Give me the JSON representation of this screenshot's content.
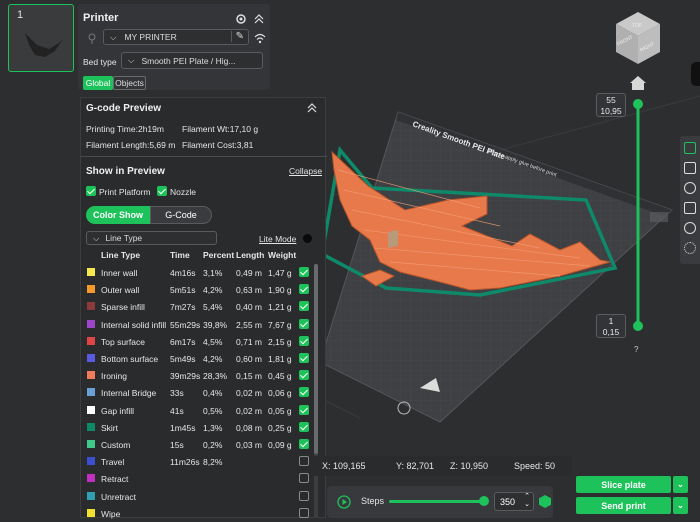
{
  "plate": {
    "number": "1"
  },
  "printer": {
    "title": "Printer",
    "printer_name": "MY PRINTER",
    "bed_type_label": "Bed type",
    "bed_type_value": "Smooth PEI Plate / Hig...",
    "tab_global": "Global",
    "tab_objects": "Objects"
  },
  "gcode": {
    "title": "G-code Preview",
    "printing_time": "Printing Time:2h19m",
    "filament_wt": "Filament Wt:17,10 g",
    "filament_length": "Filament Length:5,69 m",
    "filament_cost": "Filament Cost:3,81"
  },
  "show": {
    "title": "Show in Preview",
    "collapse": "Collapse",
    "print_platform": "Print Platform",
    "nozzle": "Nozzle",
    "color_show": "Color Show",
    "gcode_tab": "G-Code",
    "line_type_select": "Line Type",
    "lite_mode": "Lite Mode"
  },
  "table": {
    "headers": [
      "Line Type",
      "Time",
      "Percent",
      "Length",
      "Weight"
    ],
    "rows": [
      {
        "color": "#f5e84a",
        "name": "Inner wall",
        "time": "4m16s",
        "percent": "3,1%",
        "length": "0,49 m",
        "weight": "1,47 g",
        "checked": true
      },
      {
        "color": "#f59a2a",
        "name": "Outer wall",
        "time": "5m51s",
        "percent": "4,2%",
        "length": "0,63 m",
        "weight": "1,90 g",
        "checked": true
      },
      {
        "color": "#8b3a3a",
        "name": "Sparse infill",
        "time": "7m27s",
        "percent": "5,4%",
        "length": "0,40 m",
        "weight": "1,21 g",
        "checked": true
      },
      {
        "color": "#9b45c9",
        "name": "Internal solid infill",
        "time": "55m29s",
        "percent": "39,8%",
        "length": "2,55 m",
        "weight": "7,67 g",
        "checked": true
      },
      {
        "color": "#e04545",
        "name": "Top surface",
        "time": "6m17s",
        "percent": "4,5%",
        "length": "0,71 m",
        "weight": "2,15 g",
        "checked": true
      },
      {
        "color": "#5a5ae0",
        "name": "Bottom surface",
        "time": "5m49s",
        "percent": "4,2%",
        "length": "0,60 m",
        "weight": "1,81 g",
        "checked": true
      },
      {
        "color": "#f07a5a",
        "name": "Ironing",
        "time": "39m29s",
        "percent": "28,3%",
        "length": "0,15 m",
        "weight": "0,45 g",
        "checked": true
      },
      {
        "color": "#6aa0d8",
        "name": "Internal Bridge",
        "time": "33s",
        "percent": "0,4%",
        "length": "0,02 m",
        "weight": "0,06 g",
        "checked": true
      },
      {
        "color": "#ffffff",
        "name": "Gap infill",
        "time": "41s",
        "percent": "0,5%",
        "length": "0,02 m",
        "weight": "0,05 g",
        "checked": true
      },
      {
        "color": "#0e8a6a",
        "name": "Skirt",
        "time": "1m45s",
        "percent": "1,3%",
        "length": "0,08 m",
        "weight": "0,25 g",
        "checked": true
      },
      {
        "color": "#3ec88a",
        "name": "Custom",
        "time": "15s",
        "percent": "0,2%",
        "length": "0,03 m",
        "weight": "0,09 g",
        "checked": true
      },
      {
        "color": "#3a4fd0",
        "name": "Travel",
        "time": "11m26s",
        "percent": "8,2%",
        "length": "",
        "weight": "",
        "checked": false
      },
      {
        "color": "#c030c0",
        "name": "Retract",
        "time": "",
        "percent": "",
        "length": "",
        "weight": "",
        "checked": false
      },
      {
        "color": "#30a0b0",
        "name": "Unretract",
        "time": "",
        "percent": "",
        "length": "",
        "weight": "",
        "checked": false
      },
      {
        "color": "#f0e030",
        "name": "Wipe",
        "time": "",
        "percent": "",
        "length": "",
        "weight": "",
        "checked": false
      }
    ]
  },
  "viewport": {
    "plate_label": "Creality Smooth PEI Plate",
    "plate_hint": "please apply glue before print",
    "cube_top": "TOP",
    "cube_front": "FRONT",
    "cube_right": "RIGHT"
  },
  "layer_slider": {
    "top_layer": "55",
    "top_height": "10,95",
    "bottom_layer": "1",
    "bottom_height": "0,15",
    "help": "?"
  },
  "coords": {
    "x": "X: 109,165",
    "y": "Y: 82,701",
    "z": "Z: 10,950",
    "speed": "Speed: 50"
  },
  "steps": {
    "label": "Steps",
    "value": "350"
  },
  "actions": {
    "slice": "Slice plate",
    "send": "Send print"
  },
  "colors": {
    "accent": "#1ec25a",
    "print": "#e8794a",
    "skirt": "#0e8a6a"
  }
}
